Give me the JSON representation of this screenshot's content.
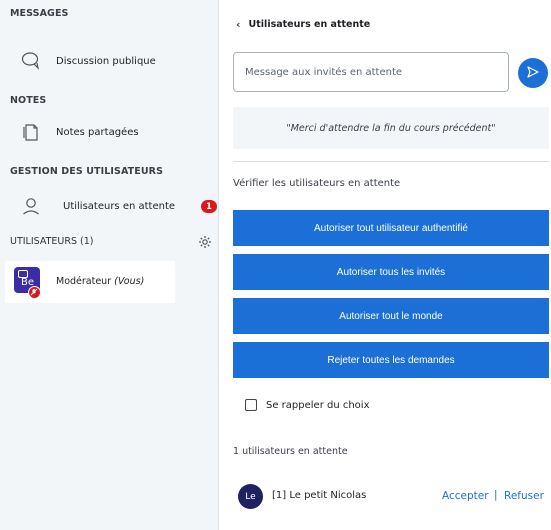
{
  "sidebar": {
    "messages_title": "MESSAGES",
    "public_chat": "Discussion publique",
    "notes_title": "NOTES",
    "shared_notes": "Notes partagées",
    "user_management_title": "GESTION DES UTILISATEURS",
    "waiting_users": "Utilisateurs en attente",
    "waiting_badge": "1",
    "users_title": "UTILISATEURS (1)",
    "moderator": {
      "initials": "Be",
      "name": "Modérateur",
      "you_suffix": "(Vous)"
    }
  },
  "panel": {
    "back_label": "Utilisateurs en attente",
    "message_placeholder": "Message aux invités en attente",
    "guest_message": "\"Merci d'attendre la fin du cours précédent\"",
    "verify_label": "Vérifier les utilisateurs en attente",
    "buttons": {
      "allow_authenticated": "Autoriser tout utilisateur authentifié",
      "allow_guests": "Autoriser tous les invités",
      "allow_everyone": "Autoriser tout le monde",
      "reject_all": "Rejeter toutes les demandes"
    },
    "remember_label": "Se rappeler du choix",
    "waiting_count": "1 utilisateurs en attente",
    "waiting_user": {
      "initials": "Le",
      "name": "[1] Le petit Nicolas",
      "accept": "Accepter",
      "separator": "|",
      "refuse": "Refuser"
    }
  },
  "colors": {
    "accent": "#1b6fd6",
    "sidebar_bg": "#f3f6f9",
    "badge": "#d9191c",
    "moderator_avatar": "#3a2ea8",
    "user_avatar": "#1e2260"
  },
  "icons": [
    "chat-bubble-icon",
    "notes-icon",
    "user-icon",
    "gear-icon",
    "chevron-left-icon",
    "send-icon",
    "mic-muted-icon"
  ]
}
